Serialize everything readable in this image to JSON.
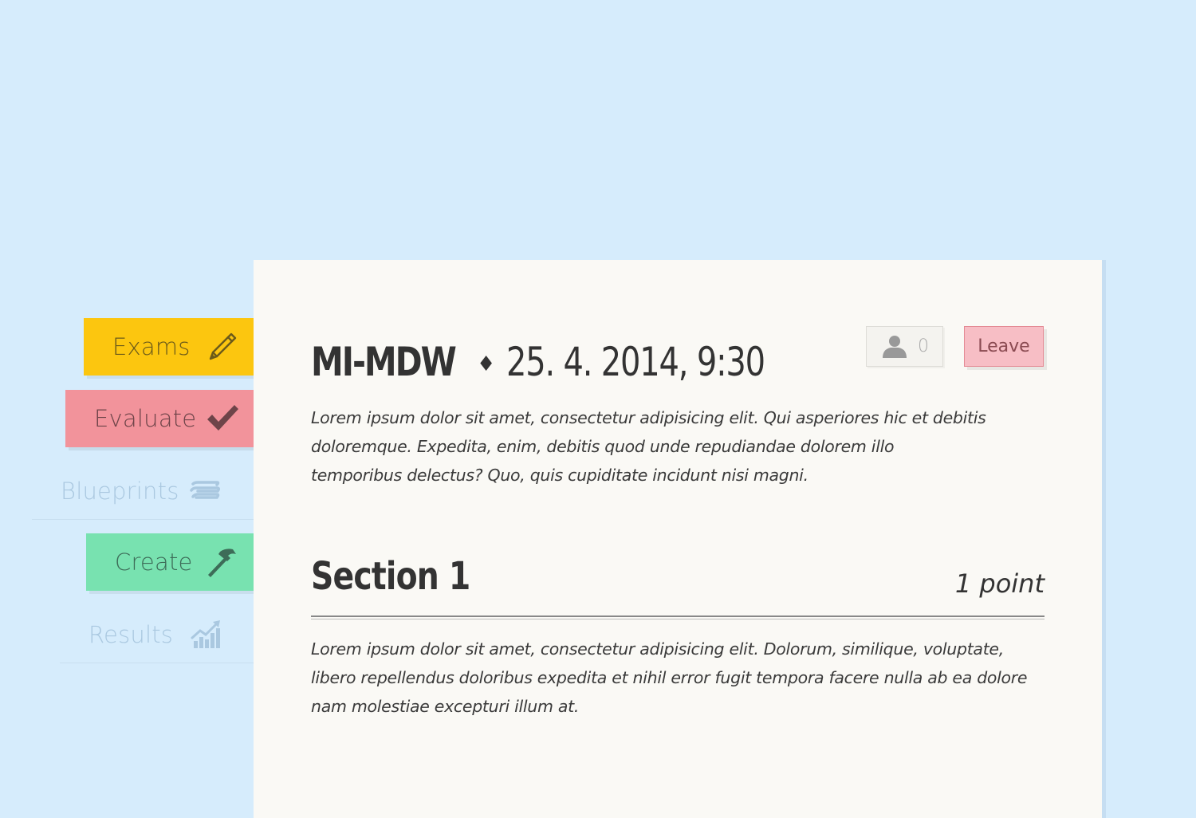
{
  "sidebar": {
    "items": [
      {
        "label": "Exams",
        "icon": "pencil-icon",
        "color": "#fcc60f",
        "active": true
      },
      {
        "label": "Evaluate",
        "icon": "checkmark-icon",
        "color": "#f2939b",
        "active": true
      },
      {
        "label": "Blueprints",
        "icon": "layers-icon",
        "active": false
      },
      {
        "label": "Create",
        "icon": "hammer-icon",
        "color": "#78e2b0",
        "active": true
      },
      {
        "label": "Results",
        "icon": "chart-icon",
        "active": false
      }
    ]
  },
  "exam": {
    "code": "MI-MDW",
    "separator": "♦",
    "datetime": "25. 4. 2014, 9:30",
    "participants_count": "0",
    "leave_label": "Leave",
    "description": "Lorem ipsum dolor sit amet, consectetur adipisicing elit. Qui asperiores hic et debitis doloremque. Expedita, enim, debitis quod unde repudiandae dolorem illo temporibus delectus? Quo, quis cupiditate incidunt nisi magni."
  },
  "section": {
    "title": "Section 1",
    "points": "1 point",
    "text": "Lorem ipsum dolor sit amet, consectetur adipisicing elit. Dolorum, similique, voluptate, libero repellendus doloribus expedita et nihil error fugit tempora facere nulla ab ea dolore nam molestiae excepturi illum at."
  },
  "colors": {
    "background": "#d6ecfc",
    "card": "#faf9f5",
    "leave_button": "#f7bec5"
  }
}
